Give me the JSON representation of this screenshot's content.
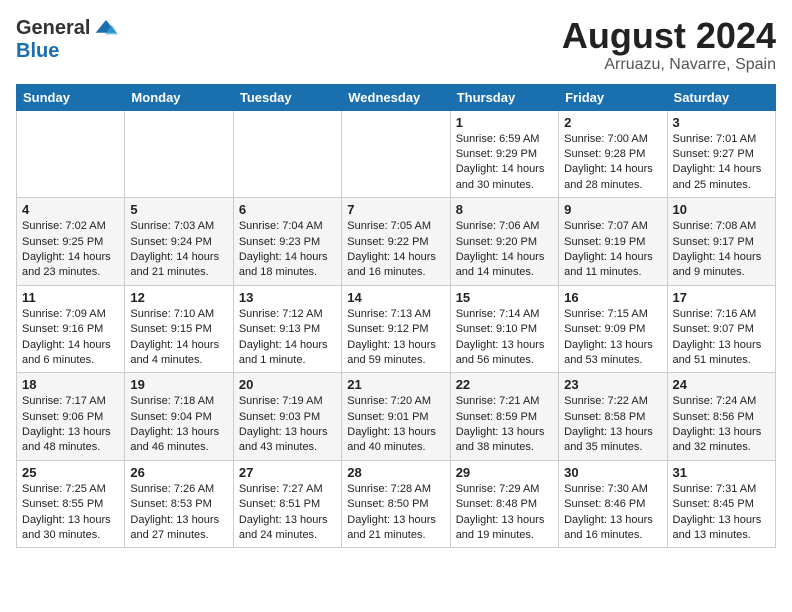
{
  "header": {
    "logo_general": "General",
    "logo_blue": "Blue",
    "month_year": "August 2024",
    "location": "Arruazu, Navarre, Spain"
  },
  "weekdays": [
    "Sunday",
    "Monday",
    "Tuesday",
    "Wednesday",
    "Thursday",
    "Friday",
    "Saturday"
  ],
  "weeks": [
    [
      {
        "day": "",
        "info": ""
      },
      {
        "day": "",
        "info": ""
      },
      {
        "day": "",
        "info": ""
      },
      {
        "day": "",
        "info": ""
      },
      {
        "day": "1",
        "info": "Sunrise: 6:59 AM\nSunset: 9:29 PM\nDaylight: 14 hours\nand 30 minutes."
      },
      {
        "day": "2",
        "info": "Sunrise: 7:00 AM\nSunset: 9:28 PM\nDaylight: 14 hours\nand 28 minutes."
      },
      {
        "day": "3",
        "info": "Sunrise: 7:01 AM\nSunset: 9:27 PM\nDaylight: 14 hours\nand 25 minutes."
      }
    ],
    [
      {
        "day": "4",
        "info": "Sunrise: 7:02 AM\nSunset: 9:25 PM\nDaylight: 14 hours\nand 23 minutes."
      },
      {
        "day": "5",
        "info": "Sunrise: 7:03 AM\nSunset: 9:24 PM\nDaylight: 14 hours\nand 21 minutes."
      },
      {
        "day": "6",
        "info": "Sunrise: 7:04 AM\nSunset: 9:23 PM\nDaylight: 14 hours\nand 18 minutes."
      },
      {
        "day": "7",
        "info": "Sunrise: 7:05 AM\nSunset: 9:22 PM\nDaylight: 14 hours\nand 16 minutes."
      },
      {
        "day": "8",
        "info": "Sunrise: 7:06 AM\nSunset: 9:20 PM\nDaylight: 14 hours\nand 14 minutes."
      },
      {
        "day": "9",
        "info": "Sunrise: 7:07 AM\nSunset: 9:19 PM\nDaylight: 14 hours\nand 11 minutes."
      },
      {
        "day": "10",
        "info": "Sunrise: 7:08 AM\nSunset: 9:17 PM\nDaylight: 14 hours\nand 9 minutes."
      }
    ],
    [
      {
        "day": "11",
        "info": "Sunrise: 7:09 AM\nSunset: 9:16 PM\nDaylight: 14 hours\nand 6 minutes."
      },
      {
        "day": "12",
        "info": "Sunrise: 7:10 AM\nSunset: 9:15 PM\nDaylight: 14 hours\nand 4 minutes."
      },
      {
        "day": "13",
        "info": "Sunrise: 7:12 AM\nSunset: 9:13 PM\nDaylight: 14 hours\nand 1 minute."
      },
      {
        "day": "14",
        "info": "Sunrise: 7:13 AM\nSunset: 9:12 PM\nDaylight: 13 hours\nand 59 minutes."
      },
      {
        "day": "15",
        "info": "Sunrise: 7:14 AM\nSunset: 9:10 PM\nDaylight: 13 hours\nand 56 minutes."
      },
      {
        "day": "16",
        "info": "Sunrise: 7:15 AM\nSunset: 9:09 PM\nDaylight: 13 hours\nand 53 minutes."
      },
      {
        "day": "17",
        "info": "Sunrise: 7:16 AM\nSunset: 9:07 PM\nDaylight: 13 hours\nand 51 minutes."
      }
    ],
    [
      {
        "day": "18",
        "info": "Sunrise: 7:17 AM\nSunset: 9:06 PM\nDaylight: 13 hours\nand 48 minutes."
      },
      {
        "day": "19",
        "info": "Sunrise: 7:18 AM\nSunset: 9:04 PM\nDaylight: 13 hours\nand 46 minutes."
      },
      {
        "day": "20",
        "info": "Sunrise: 7:19 AM\nSunset: 9:03 PM\nDaylight: 13 hours\nand 43 minutes."
      },
      {
        "day": "21",
        "info": "Sunrise: 7:20 AM\nSunset: 9:01 PM\nDaylight: 13 hours\nand 40 minutes."
      },
      {
        "day": "22",
        "info": "Sunrise: 7:21 AM\nSunset: 8:59 PM\nDaylight: 13 hours\nand 38 minutes."
      },
      {
        "day": "23",
        "info": "Sunrise: 7:22 AM\nSunset: 8:58 PM\nDaylight: 13 hours\nand 35 minutes."
      },
      {
        "day": "24",
        "info": "Sunrise: 7:24 AM\nSunset: 8:56 PM\nDaylight: 13 hours\nand 32 minutes."
      }
    ],
    [
      {
        "day": "25",
        "info": "Sunrise: 7:25 AM\nSunset: 8:55 PM\nDaylight: 13 hours\nand 30 minutes."
      },
      {
        "day": "26",
        "info": "Sunrise: 7:26 AM\nSunset: 8:53 PM\nDaylight: 13 hours\nand 27 minutes."
      },
      {
        "day": "27",
        "info": "Sunrise: 7:27 AM\nSunset: 8:51 PM\nDaylight: 13 hours\nand 24 minutes."
      },
      {
        "day": "28",
        "info": "Sunrise: 7:28 AM\nSunset: 8:50 PM\nDaylight: 13 hours\nand 21 minutes."
      },
      {
        "day": "29",
        "info": "Sunrise: 7:29 AM\nSunset: 8:48 PM\nDaylight: 13 hours\nand 19 minutes."
      },
      {
        "day": "30",
        "info": "Sunrise: 7:30 AM\nSunset: 8:46 PM\nDaylight: 13 hours\nand 16 minutes."
      },
      {
        "day": "31",
        "info": "Sunrise: 7:31 AM\nSunset: 8:45 PM\nDaylight: 13 hours\nand 13 minutes."
      }
    ]
  ]
}
